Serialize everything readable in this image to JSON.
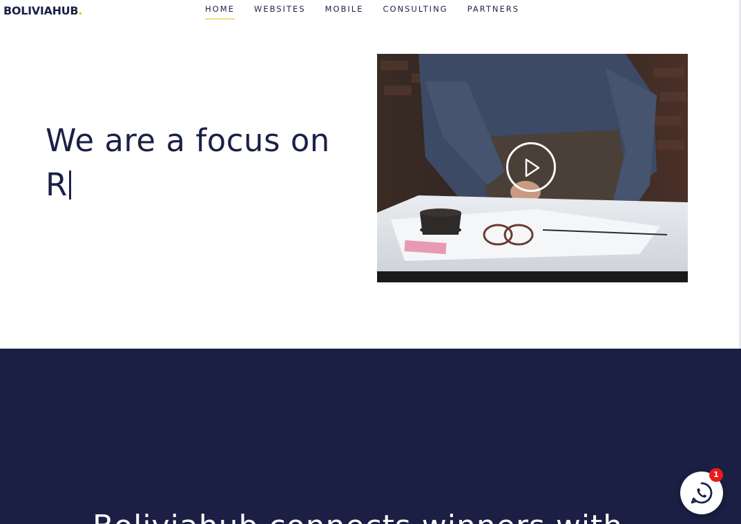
{
  "header": {
    "logo_text": "BOLIVIAHUB",
    "logo_dot": ".",
    "nav": [
      {
        "label": "HOME",
        "active": true
      },
      {
        "label": "WEBSITES",
        "active": false
      },
      {
        "label": "MOBILE",
        "active": false
      },
      {
        "label": "CONSULTING",
        "active": false
      },
      {
        "label": "PARTNERS",
        "active": false
      }
    ]
  },
  "hero": {
    "headline_line1": "We are a focus on",
    "headline_line2": "R",
    "video": {
      "play_icon": "play-icon"
    }
  },
  "section_two": {
    "heading": "Boliviahub connects winners with"
  },
  "whatsapp": {
    "icon": "whatsapp-icon",
    "badge_count": "1"
  },
  "colors": {
    "brand_navy": "#1b2145",
    "accent_yellow": "#f2b21b",
    "dark_section_bg": "#1a1f43",
    "badge_red": "#e81c1c"
  }
}
